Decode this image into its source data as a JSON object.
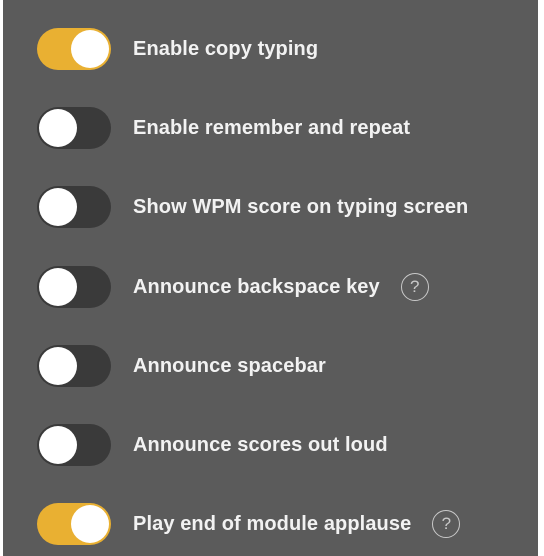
{
  "settings": [
    {
      "label": "Enable copy typing",
      "enabled": true,
      "help": false
    },
    {
      "label": "Enable remember and repeat",
      "enabled": false,
      "help": false
    },
    {
      "label": "Show WPM score on typing screen",
      "enabled": false,
      "help": false
    },
    {
      "label": "Announce backspace key",
      "enabled": false,
      "help": true
    },
    {
      "label": "Announce spacebar",
      "enabled": false,
      "help": false
    },
    {
      "label": "Announce scores out loud",
      "enabled": false,
      "help": false
    },
    {
      "label": "Play end of module applause",
      "enabled": true,
      "help": true
    }
  ],
  "help_glyph": "?",
  "colors": {
    "panel": "#5b5b5b",
    "toggle_on": "#e9b032",
    "toggle_off": "#3a3a3a"
  }
}
